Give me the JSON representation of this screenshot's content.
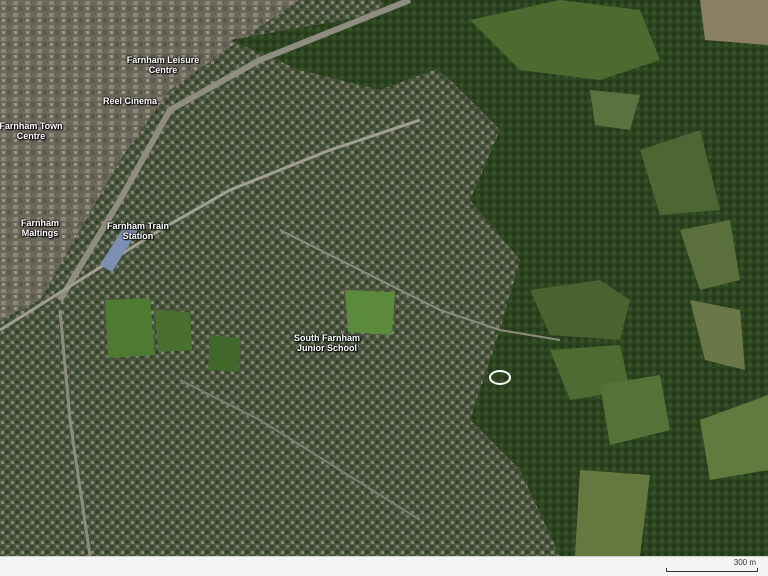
{
  "map": {
    "labels": {
      "leisure_centre": "Farnham Leisure\nCentre",
      "cinema": "Reel Cinema",
      "town_centre": "Farnham Town\nCentre",
      "maltings": "Farnham\nMaltings",
      "train_station": "Farnham Train\nStation",
      "junior_school": "South Farnham\nJunior School"
    },
    "marker": "location-ring",
    "scale": {
      "label": "300 m"
    }
  },
  "colors": {
    "woodland": "#2f4a23",
    "field": "#4f6b34",
    "urban": "#6b6a5c",
    "road": "#9a9a8e",
    "marker": "#ffffff"
  }
}
